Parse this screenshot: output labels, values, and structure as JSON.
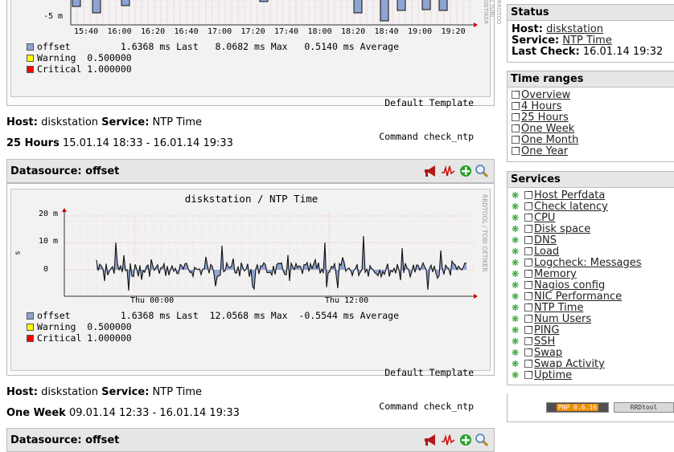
{
  "graph1": {
    "y_tick_labels": [
      "-5 m"
    ],
    "x_tick_labels": [
      "15:40",
      "16:00",
      "16:20",
      "16:40",
      "17:00",
      "17:20",
      "17:40",
      "18:00",
      "18:20",
      "18:40",
      "19:00",
      "19:20"
    ],
    "side_label": "RRDTOOL / TOBI OETIKER"
  },
  "legend1": {
    "offset": "offset         1.6368 ms Last   8.0682 ms Max   0.5140 ms Average",
    "warning": "Warning  0.500000",
    "critical": "Critical 1.000000",
    "template": "Default Template",
    "command": "Command check_ntp"
  },
  "info1": {
    "host_label": "Host:",
    "host": "diskstation",
    "service_label": "Service:",
    "service": "NTP Time",
    "range_label": "25 Hours",
    "range": "15.01.14 18:33 - 16.01.14 19:33"
  },
  "datasource1": {
    "label": "Datasource: offset"
  },
  "graph2": {
    "title": "diskstation / NTP Time",
    "y_axis_label": "s",
    "y_tick_labels": [
      "20 m",
      "10 m",
      "0"
    ],
    "x_tick_labels": [
      "Thu 00:00",
      "Thu 12:00"
    ],
    "side_label": "RRDTOOL / TOBI OETIKER"
  },
  "legend2": {
    "offset": "offset         1.6368 ms Last  12.0568 ms Max  -0.5544 ms Average",
    "warning": "Warning  0.500000",
    "critical": "Critical 1.000000",
    "template": "Default Template",
    "command": "Command check_ntp"
  },
  "info2": {
    "host_label": "Host:",
    "host": "diskstation",
    "service_label": "Service:",
    "service": "NTP Time",
    "range_label": "One Week",
    "range": "09.01.14 12:33 - 16.01.14 19:33"
  },
  "datasource2": {
    "label": "Datasource: offset"
  },
  "status": {
    "title": "Status",
    "host_label": "Host:",
    "host": "diskstation",
    "service_label": "Service:",
    "service": "NTP Time",
    "last_check_label": "Last Check:",
    "last_check": "16.01.14 19:32"
  },
  "time_ranges": {
    "title": "Time ranges",
    "items": [
      "Overview",
      "4 Hours",
      "25 Hours",
      "One Week",
      "One Month",
      "One Year"
    ]
  },
  "services": {
    "title": "Services",
    "items": [
      "Host Perfdata",
      "Check latency",
      "CPU",
      "Disk space",
      "DNS",
      "Load",
      "Logcheck: Messages",
      "Memory",
      "Nagios config",
      "NIC Performance",
      "NTP Time",
      "Num Users",
      "PING",
      "SSH",
      "Swap",
      "Swap Activity",
      "Uptime"
    ]
  },
  "footer": {
    "pnp_badge": "PNP 0.6.16",
    "rrd_badge": "RRDtool"
  },
  "colors": {
    "offset": "#8ea4d2",
    "warning": "#ffff00",
    "critical": "#ff0000",
    "panel_header": "#e6e6e6",
    "service_icon": "#1a9a1a"
  },
  "icons": [
    "megaphone-icon",
    "graph-icon",
    "add-icon",
    "zoom-icon",
    "gear-icon",
    "external-link-icon"
  ]
}
